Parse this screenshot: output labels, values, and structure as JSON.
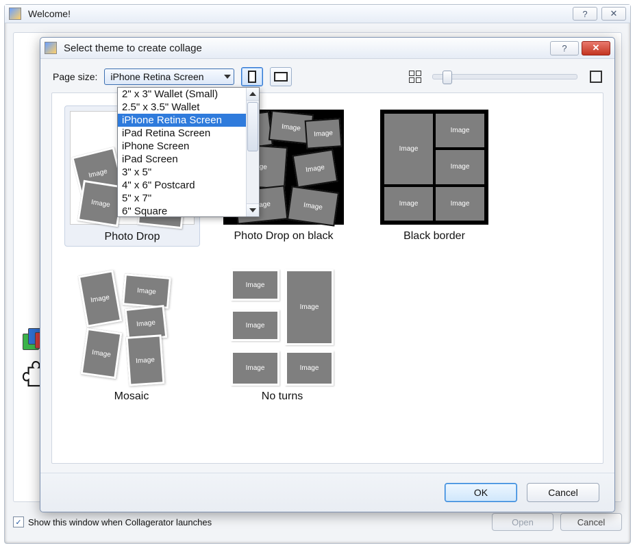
{
  "main_window": {
    "title": "Welcome!",
    "checkbox_label": "Show this window when Collagerator launches",
    "checkbox_checked": true,
    "buttons": {
      "open": "Open",
      "cancel": "Cancel"
    }
  },
  "dialog": {
    "title": "Select theme to create collage",
    "page_size": {
      "label": "Page size:",
      "selected": "iPhone Retina Screen",
      "options": [
        "2\" x 3\" Wallet (Small)",
        "2.5\" x 3.5\" Wallet",
        "iPhone Retina Screen",
        "iPad Retina Screen",
        "iPhone Screen",
        "iPad Screen",
        "3\" x 5\"",
        "4\" x 6\" Postcard",
        "5\" x 7\"",
        "6\" Square"
      ],
      "highlighted_index": 2
    },
    "orientation": {
      "portrait_active": true,
      "landscape_active": false
    },
    "themes": [
      {
        "name": "Photo Drop",
        "selected": true
      },
      {
        "name": "Photo Drop on black",
        "selected": false
      },
      {
        "name": "Black border",
        "selected": false
      },
      {
        "name": "Mosaic",
        "selected": false
      },
      {
        "name": "No turns",
        "selected": false
      }
    ],
    "placeholder_word": "Image",
    "buttons": {
      "ok": "OK",
      "cancel": "Cancel"
    }
  }
}
